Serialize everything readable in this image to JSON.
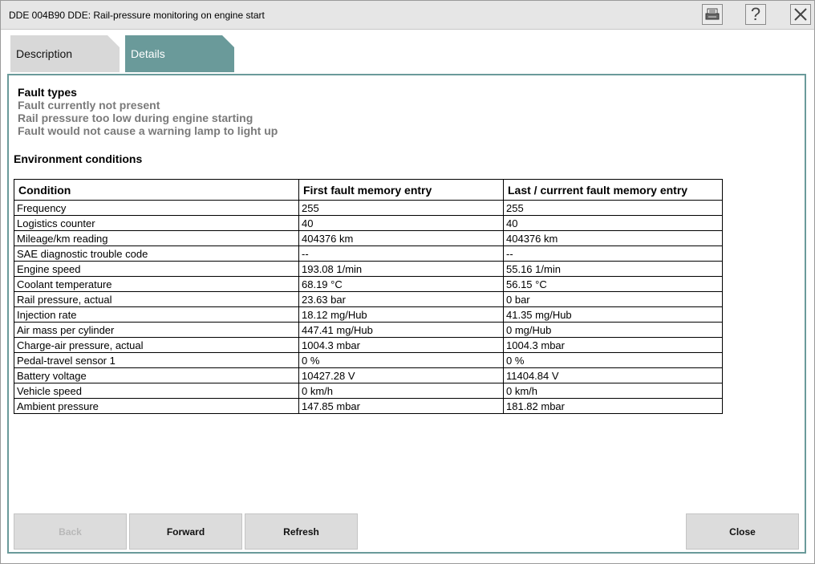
{
  "window": {
    "title": "DDE 004B90 DDE: Rail-pressure monitoring on engine start",
    "help_glyph": "?"
  },
  "tabs": [
    {
      "label": "Description",
      "active": false
    },
    {
      "label": "Details",
      "active": true
    }
  ],
  "fault_types": {
    "title": "Fault types",
    "lines": [
      "Fault currently not present",
      "Rail pressure too low during engine starting",
      "Fault would not cause a warning lamp to light up"
    ]
  },
  "environment": {
    "title": "Environment conditions",
    "columns": [
      "Condition",
      "First fault memory entry",
      "Last / currrent fault memory entry"
    ],
    "rows": [
      [
        "Frequency",
        "255",
        "255"
      ],
      [
        "Logistics counter",
        "40",
        "40"
      ],
      [
        "Mileage/km reading",
        "404376 km",
        "404376 km"
      ],
      [
        "SAE diagnostic trouble code",
        "--",
        "--"
      ],
      [
        "Engine speed",
        "193.08 1/min",
        "55.16 1/min"
      ],
      [
        "Coolant temperature",
        "68.19 °C",
        "56.15 °C"
      ],
      [
        "Rail pressure, actual",
        "23.63 bar",
        "0 bar"
      ],
      [
        "Injection rate",
        "18.12 mg/Hub",
        "41.35 mg/Hub"
      ],
      [
        "Air mass per cylinder",
        "447.41 mg/Hub",
        "0 mg/Hub"
      ],
      [
        "Charge-air pressure, actual",
        "1004.3 mbar",
        "1004.3 mbar"
      ],
      [
        "Pedal-travel sensor 1",
        "0 %",
        "0 %"
      ],
      [
        "Battery voltage",
        "10427.28 V",
        "11404.84 V"
      ],
      [
        "Vehicle speed",
        "0 km/h",
        "0 km/h"
      ],
      [
        "Ambient pressure",
        "147.85 mbar",
        "181.82 mbar"
      ]
    ]
  },
  "buttons": {
    "back": "Back",
    "forward": "Forward",
    "refresh": "Refresh",
    "close": "Close"
  },
  "colors": {
    "accent": "#6a9a9a",
    "disabled_text": "#b8b8b8",
    "subtitle_gray": "#7a7a7a"
  },
  "icons": {
    "print": "print-icon",
    "help": "help-icon",
    "close": "close-icon"
  }
}
